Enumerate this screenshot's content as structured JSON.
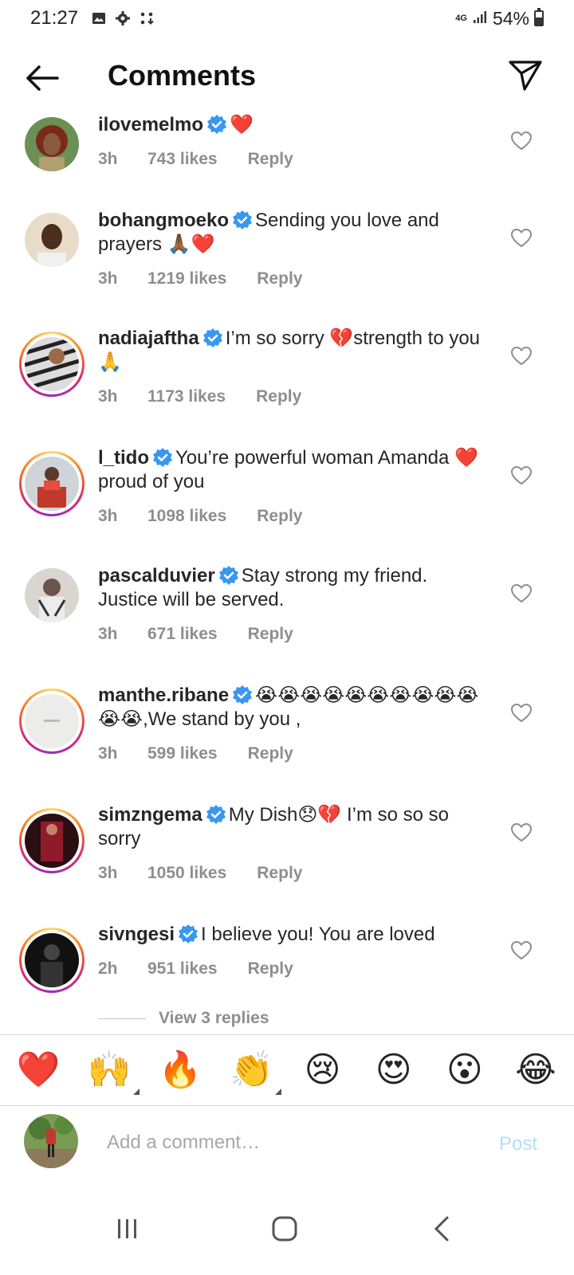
{
  "status_bar": {
    "time": "21:27",
    "network": "4G",
    "battery": "54%",
    "battery_level": 0.54
  },
  "header": {
    "title": "Comments"
  },
  "comments": [
    {
      "username": "ilovemelmo",
      "verified": true,
      "text": "❤️",
      "time": "3h",
      "likes": "743 likes",
      "reply": "Reply",
      "ring": false
    },
    {
      "username": "bohangmoeko",
      "verified": true,
      "text": "Sending you love and prayers 🙏🏾❤️",
      "time": "3h",
      "likes": "1219 likes",
      "reply": "Reply",
      "ring": false
    },
    {
      "username": "nadiajaftha",
      "verified": true,
      "text": "I’m so sorry 💔strength to you🙏",
      "time": "3h",
      "likes": "1173 likes",
      "reply": "Reply",
      "ring": true
    },
    {
      "username": "l_tido",
      "verified": true,
      "text": "You’re powerful woman Amanda ❤️ proud of you",
      "time": "3h",
      "likes": "1098 likes",
      "reply": "Reply",
      "ring": true
    },
    {
      "username": "pascalduvier",
      "verified": true,
      "text": "Stay strong my friend. Justice will be served.",
      "time": "3h",
      "likes": "671 likes",
      "reply": "Reply",
      "ring": false
    },
    {
      "username": "manthe.ribane",
      "verified": true,
      "text": "😭😭😭😭😭😭😭😭😭😭😭😭,We stand by you ,",
      "time": "3h",
      "likes": "599 likes",
      "reply": "Reply",
      "ring": true
    },
    {
      "username": "simzngema",
      "verified": true,
      "text": "My Dish😞💔 I’m so so so sorry",
      "time": "3h",
      "likes": "1050 likes",
      "reply": "Reply",
      "ring": true
    },
    {
      "username": "sivngesi",
      "verified": true,
      "text": "I believe you! You are loved",
      "time": "2h",
      "likes": "951 likes",
      "reply": "Reply",
      "ring": true
    }
  ],
  "view_replies": "View 3 replies",
  "emoji_bar": [
    "❤️",
    "🙌",
    "🔥",
    "👏",
    "😢",
    "😍",
    "😮",
    "😂"
  ],
  "input": {
    "placeholder": "Add a comment…",
    "post_label": "Post"
  },
  "colors": {
    "verified": "#3897f0",
    "heart": "#ed4956",
    "muted": "#8e8e8e",
    "post_disabled": "#b2dffc"
  }
}
